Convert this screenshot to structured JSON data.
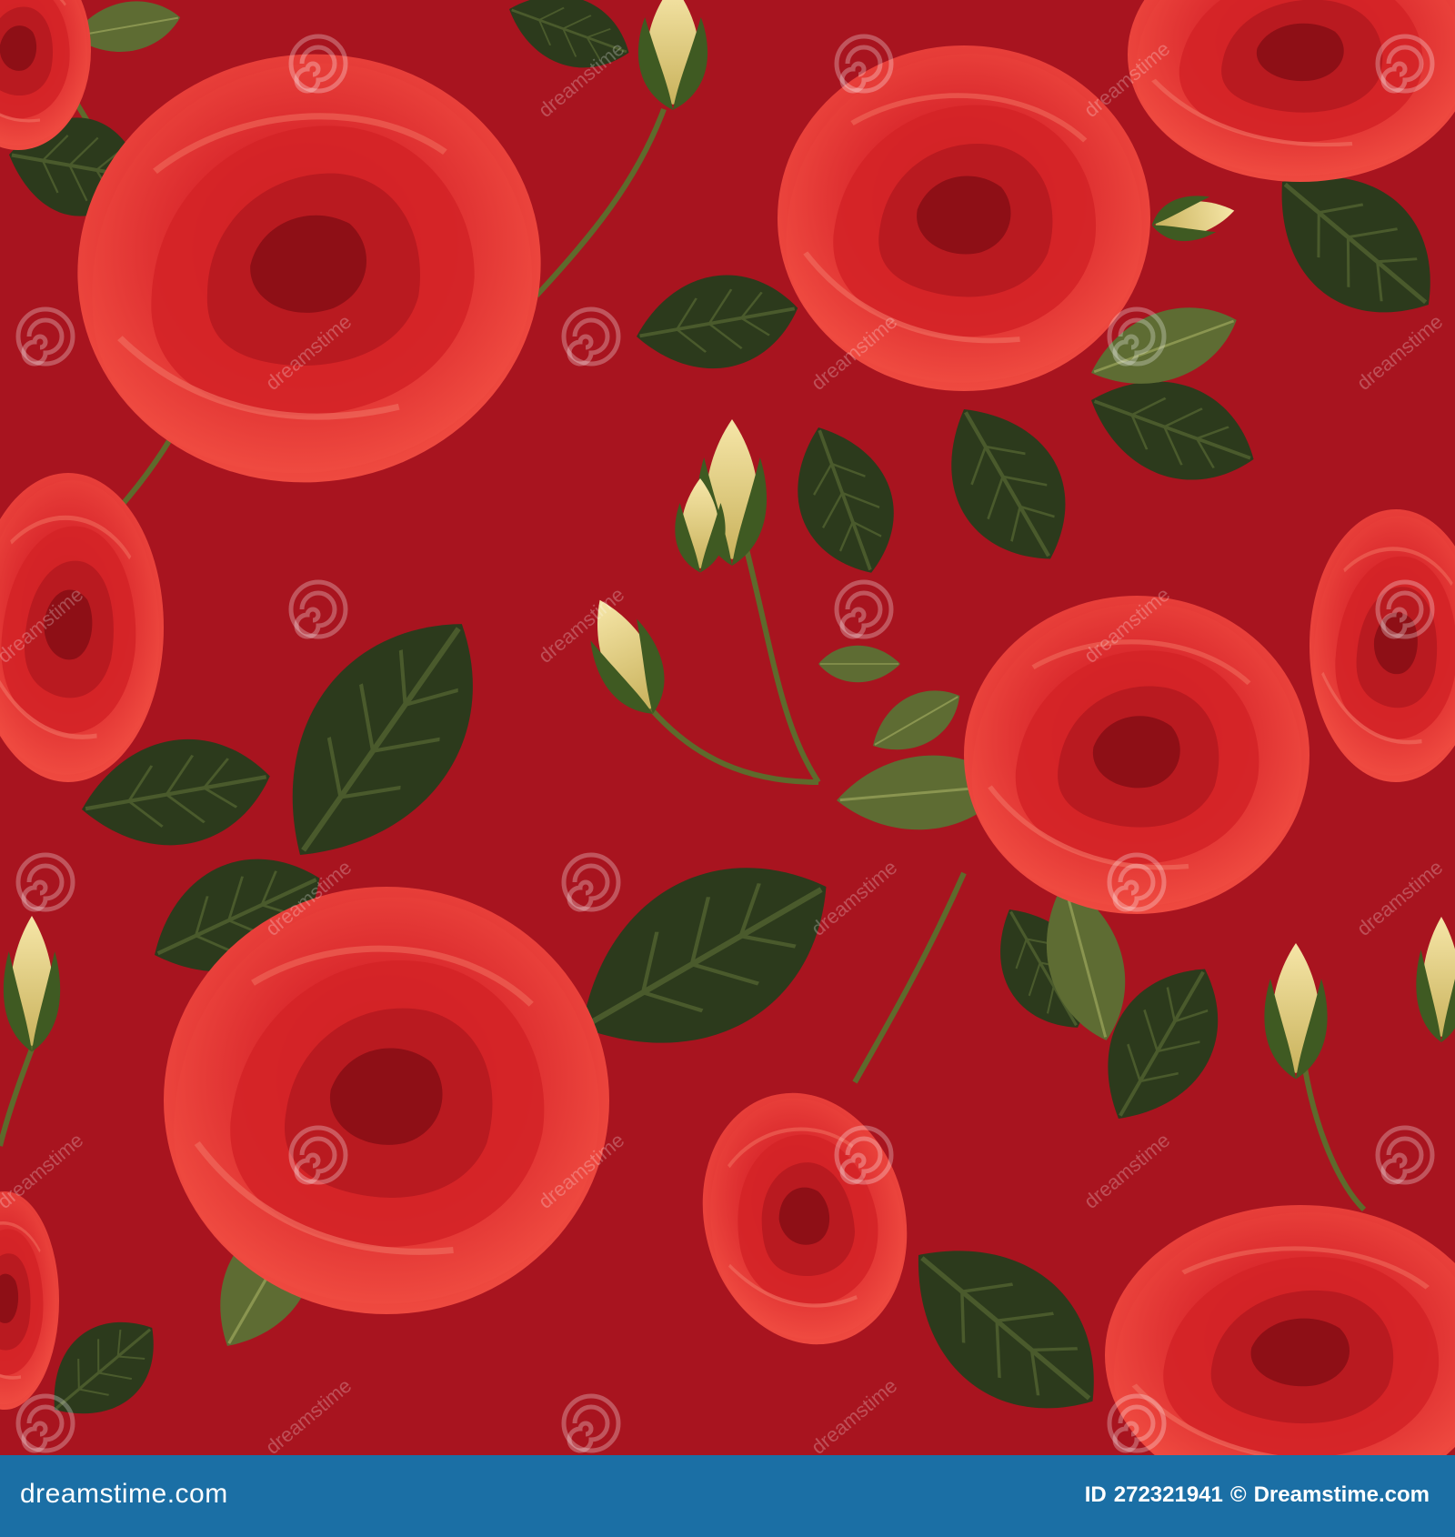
{
  "footer": {
    "site": "dreamstime.com",
    "id_label": "ID",
    "id_value": "272321941",
    "copyright_symbol": "©",
    "brand": "Dreamstime.com"
  },
  "watermark": {
    "text": "dreamstime",
    "icon": "spiral-logo-icon"
  },
  "colors": {
    "background": "#a8141f",
    "rose": "#e12a2a",
    "leaf": "#2c3a1c",
    "footer": "#1b6fa5"
  }
}
